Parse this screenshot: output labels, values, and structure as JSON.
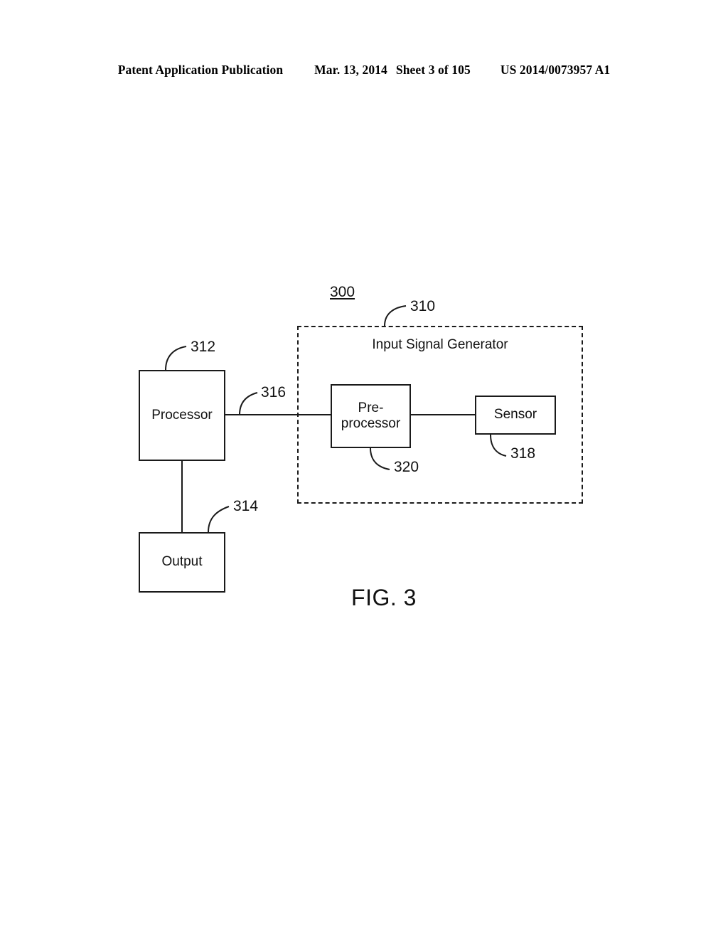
{
  "header": {
    "publication": "Patent Application Publication",
    "date": "Mar. 13, 2014",
    "sheet": "Sheet 3 of 105",
    "patent_number": "US 2014/0073957 A1"
  },
  "figure": {
    "caption": "FIG. 3",
    "system_numeral": "300",
    "container": {
      "title": "Input Signal Generator",
      "numeral": "310"
    },
    "blocks": [
      {
        "id": "processor",
        "label": "Processor",
        "numeral": "312"
      },
      {
        "id": "output",
        "label": "Output",
        "numeral": "314"
      },
      {
        "id": "preprocessor",
        "label_line1": "Pre-",
        "label_line2": "processor",
        "numeral": "320"
      },
      {
        "id": "sensor",
        "label": "Sensor",
        "numeral": "318"
      }
    ],
    "connections": [
      {
        "id": "processor-to-preprocessor",
        "numeral": "316"
      },
      {
        "id": "preprocessor-to-sensor",
        "numeral": ""
      },
      {
        "id": "processor-to-output",
        "numeral": ""
      }
    ]
  },
  "colors": {
    "ink": "#1a1a1a",
    "text": "#111111",
    "background": "#ffffff"
  }
}
